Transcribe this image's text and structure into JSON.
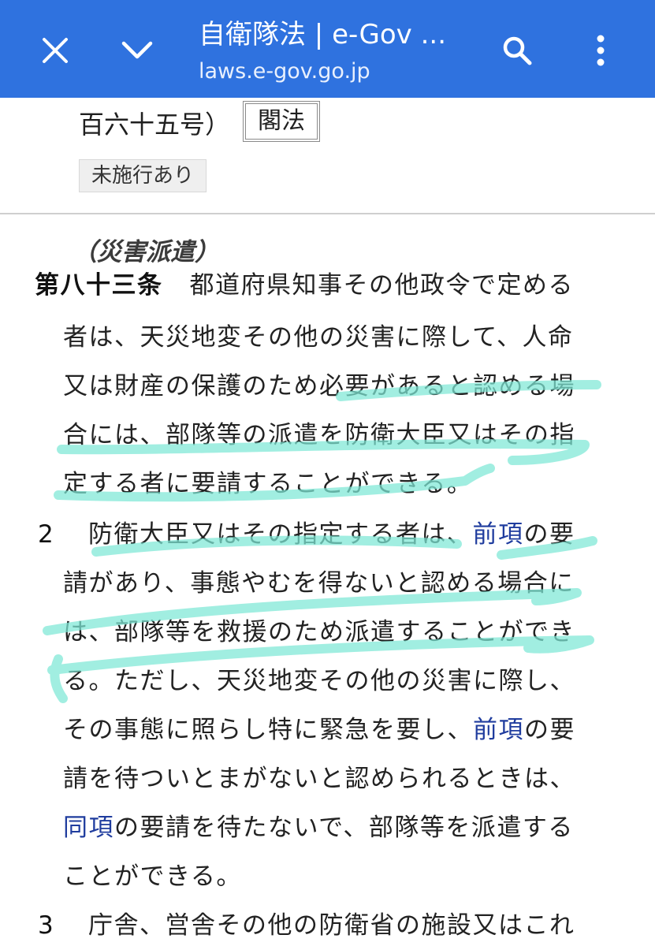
{
  "toolbar": {
    "title": "自衛隊法 | e-Gov ...",
    "url": "laws.e-gov.go.jp",
    "accent": "#2f72df"
  },
  "header": {
    "law_number_tail": "百六十五号）",
    "kaku_label": "閣法",
    "mishiko_label": "未施行あり"
  },
  "article": {
    "caption": "（災害派遣）",
    "number": "第八十三条",
    "p1": {
      "l1": "都道府県知事その他政令で定める",
      "l2": "者は、天災地変その他の災害に際して、人命",
      "l3": "又は財産の保護のため必要があると認める場",
      "l4": "合には、部隊等の派遣を防衛大臣又はその指",
      "l5": "定する者に要請することができる。"
    },
    "p2": {
      "num": "2",
      "l1a": "防衛大臣又はその指定する者は、",
      "ref1": "前項",
      "l1b": "の要",
      "l2": "請があり、事態やむを得ないと認める場合に",
      "l3": "は、部隊等を救援のため派遣することができ",
      "l4": "る。ただし、天災地変その他の災害に際し、",
      "l5a": "その事態に照らし特に緊急を要し、",
      "ref2": "前項",
      "l5b": "の要",
      "l6": "請を待ついとまがないと認められるときは、",
      "ref3": "同項",
      "l7b": "の要請を待たないで、部隊等を派遣する",
      "l8": "ことができる。"
    },
    "p3": {
      "num": "3",
      "l1": "庁舎、営舎その他の防衛省の施設又はこれ"
    }
  },
  "highlight_color": "#7ee8d6"
}
